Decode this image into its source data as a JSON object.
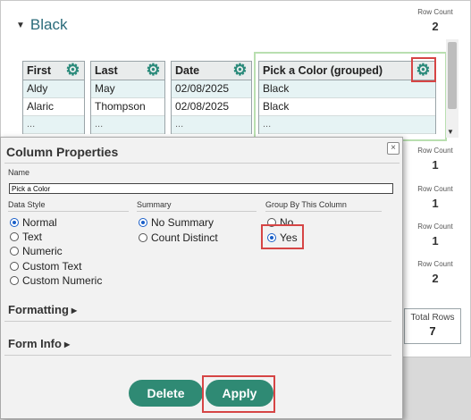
{
  "group": {
    "title": "Black",
    "row_count_label": "Row Count",
    "row_count": "2"
  },
  "columns": [
    {
      "header": "First",
      "cells": [
        "Aldy",
        "Alaric",
        "..."
      ]
    },
    {
      "header": "Last",
      "cells": [
        "May",
        "Thompson",
        "..."
      ]
    },
    {
      "header": "Date",
      "cells": [
        "02/08/2025",
        "02/08/2025",
        "..."
      ]
    },
    {
      "header": "Pick a Color (grouped)",
      "cells": [
        "Black",
        "Black",
        "..."
      ]
    }
  ],
  "side_counts": [
    {
      "label": "Row Count",
      "value": "1"
    },
    {
      "label": "Row Count",
      "value": "1"
    },
    {
      "label": "Row Count",
      "value": "1"
    },
    {
      "label": "Row Count",
      "value": "2"
    }
  ],
  "total": {
    "label": "Total Rows",
    "value": "7"
  },
  "dialog": {
    "title": "Column Properties",
    "close_glyph": "×",
    "name_label": "Name",
    "name_value": "Pick a Color",
    "data_style": {
      "label": "Data Style",
      "options": [
        "Normal",
        "Text",
        "Numeric",
        "Custom Text",
        "Custom Numeric"
      ],
      "selected": "Normal"
    },
    "summary": {
      "label": "Summary",
      "options": [
        "No Summary",
        "Count Distinct"
      ],
      "selected": "No Summary"
    },
    "group_by": {
      "label": "Group By This Column",
      "options": [
        "No",
        "Yes"
      ],
      "selected": "Yes"
    },
    "formatting_label": "Formatting",
    "form_info_label": "Form Info",
    "delete_label": "Delete",
    "apply_label": "Apply"
  },
  "colors": {
    "accent": "#2f8a74",
    "highlight": "#d64545",
    "title": "#2a6b7a"
  },
  "icons": {
    "gear": "gear-icon",
    "collapse": "triangle-down-icon",
    "expand": "triangle-right-icon"
  }
}
